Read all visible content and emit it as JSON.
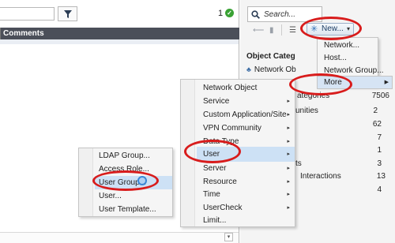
{
  "left_pane": {
    "count_label": "1",
    "table_header": {
      "column": "Comments"
    },
    "bottom_scroll_glyph": "▾"
  },
  "right_pane": {
    "search_placeholder": "Search...",
    "new_button_label": "New...",
    "object_categories_label": "Object Categ",
    "network_objects_label": "Network Ob",
    "category_rows": [
      {
        "label": "ategories",
        "count": "7506"
      },
      {
        "label": "unities",
        "count": "2"
      },
      {
        "label": "",
        "count": "62"
      },
      {
        "label": "",
        "count": "7"
      },
      {
        "label": "",
        "count": "1"
      },
      {
        "label": "ts",
        "count": "3"
      },
      {
        "label": "Interactions",
        "count": "13"
      },
      {
        "label": "",
        "count": "4"
      }
    ]
  },
  "new_menu": {
    "items": [
      "Network...",
      "Host...",
      "Network Group..."
    ],
    "more_label": "More"
  },
  "type_menu": {
    "items": [
      {
        "label": "Network Object",
        "submenu": false
      },
      {
        "label": "Service",
        "submenu": true
      },
      {
        "label": "Custom Application/Site",
        "submenu": true
      },
      {
        "label": "VPN Community",
        "submenu": true
      },
      {
        "label": "Data Type",
        "submenu": true
      },
      {
        "label": "User",
        "submenu": true
      },
      {
        "label": "Server",
        "submenu": true
      },
      {
        "label": "Resource",
        "submenu": true
      },
      {
        "label": "Time",
        "submenu": true
      },
      {
        "label": "UserCheck",
        "submenu": true
      },
      {
        "label": "Limit...",
        "submenu": false
      }
    ]
  },
  "user_menu": {
    "items": [
      "LDAP Group...",
      "Access Role...",
      "User Group...",
      "User...",
      "User Template..."
    ]
  },
  "colors": {
    "annotation": "#d81c1c",
    "menu_highlight": "#cde1f5",
    "header_bg": "#4b4f59",
    "ok_green": "#3aa234"
  }
}
